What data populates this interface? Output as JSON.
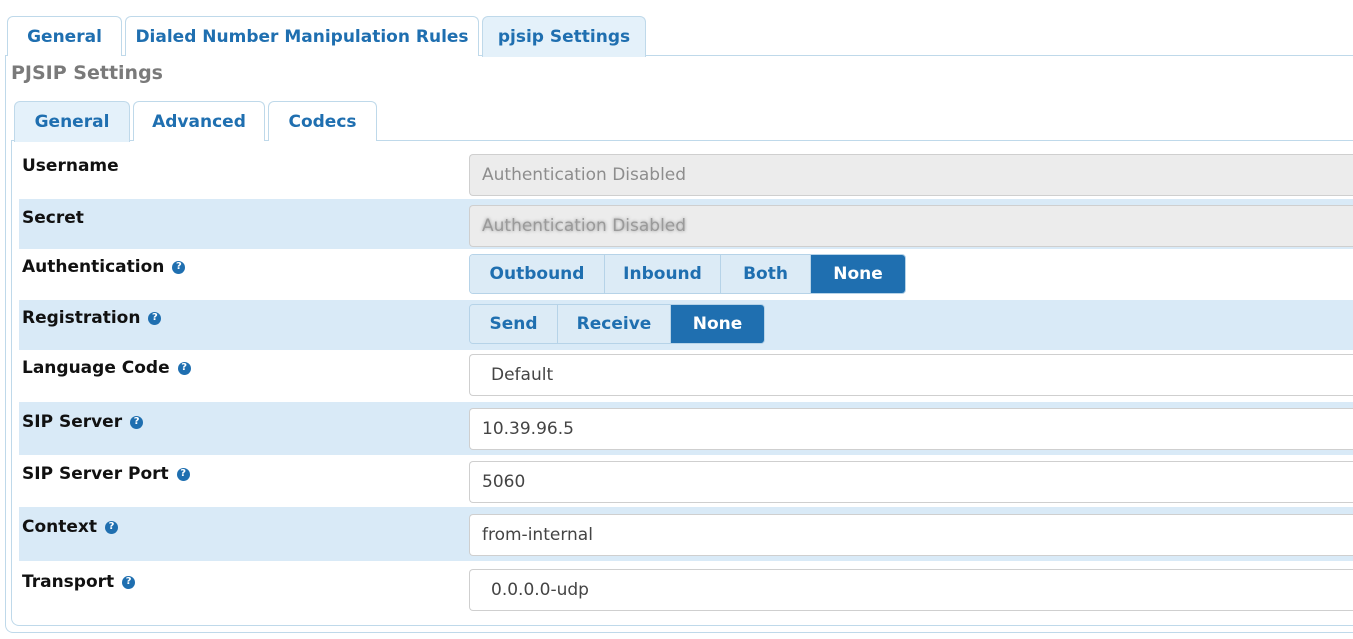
{
  "outer_tabs": [
    "General",
    "Dialed Number Manipulation Rules",
    "pjsip Settings"
  ],
  "section_title": "PJSIP Settings",
  "inner_tabs": [
    "General",
    "Advanced",
    "Codecs"
  ],
  "fields": {
    "username": {
      "label": "Username",
      "value": "Authentication Disabled"
    },
    "secret": {
      "label": "Secret",
      "value": "Authentication Disabled"
    },
    "authentication": {
      "label": "Authentication",
      "options": [
        "Outbound",
        "Inbound",
        "Both",
        "None"
      ],
      "selected": "None"
    },
    "registration": {
      "label": "Registration",
      "options": [
        "Send",
        "Receive",
        "None"
      ],
      "selected": "None"
    },
    "language_code": {
      "label": "Language Code",
      "value": "Default"
    },
    "sip_server": {
      "label": "SIP Server",
      "value": "10.39.96.5"
    },
    "sip_server_port": {
      "label": "SIP Server Port",
      "value": "5060"
    },
    "context": {
      "label": "Context",
      "value": "from-internal"
    },
    "transport": {
      "label": "Transport",
      "value": "0.0.0.0-udp"
    }
  },
  "help_icon_glyph": "?",
  "colors": {
    "accent": "#1f6fb0",
    "row_shade": "#d9eaf7",
    "tab_active": "#e4f1fa"
  }
}
